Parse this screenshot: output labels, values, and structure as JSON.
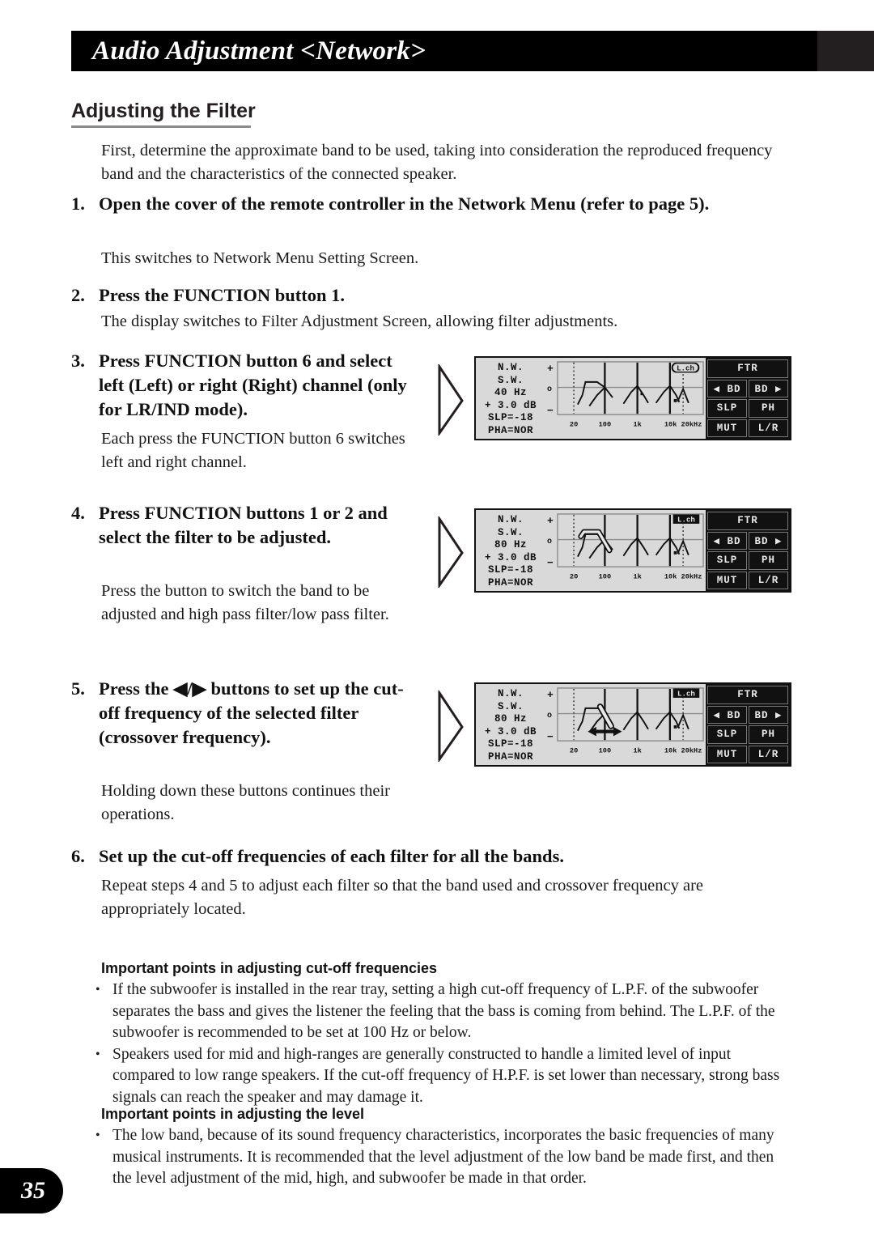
{
  "header": {
    "title": "Audio Adjustment <Network>"
  },
  "section": {
    "heading": "Adjusting the Filter"
  },
  "intro": "First, determine the approximate band to be used, taking into consideration the reproduced frequency band and the characteristics of the connected speaker.",
  "steps": [
    {
      "num": "1.",
      "title": "Open the cover of the remote controller in the Network Menu (refer to page 5).",
      "body": "This switches to Network Menu Setting Screen."
    },
    {
      "num": "2.",
      "title": "Press the FUNCTION button 1.",
      "body": "The display switches to Filter Adjustment Screen, allowing filter adjustments."
    },
    {
      "num": "3.",
      "title": "Press FUNCTION button 6 and select left (Left) or right (Right) channel (only for LR/IND mode).",
      "body": "Each press the FUNCTION button 6 switches left and right channel."
    },
    {
      "num": "4.",
      "title": "Press FUNCTION buttons 1 or 2 and select the filter to be adjusted.",
      "body": "Press the button to switch the band to be adjusted and high pass filter/low pass filter."
    },
    {
      "num": "5.",
      "title": "Press the ◀/▶ buttons to set up the cut-off frequency of the selected filter (crossover frequency).",
      "body": "Holding down these buttons continues their operations."
    },
    {
      "num": "6.",
      "title": "Set up the cut-off frequencies of each filter for all the bands.",
      "body": "Repeat steps 4 and 5 to adjust each filter so that the band used and crossover frequency are appropriately located."
    }
  ],
  "displays": [
    {
      "name": "filter-adjustment-screen-1",
      "labels": [
        "N.W.",
        "S.W.",
        "40 Hz",
        "+ 3.0 dB",
        "SLP=-18",
        "PHA=NOR"
      ],
      "axis_plus": "+",
      "axis_zero": "o",
      "axis_minus": "−",
      "channel_badge": "L.ch",
      "channel_badge_style": "rounded",
      "ticks": [
        "20",
        "100",
        "1k",
        "10k 20kHz"
      ],
      "buttons": [
        "FTR",
        "◀ BD",
        "BD ▶",
        "SLP",
        "PH",
        "MUT",
        "L/R"
      ],
      "highlight": "none",
      "arrow": false
    },
    {
      "name": "filter-adjustment-screen-2",
      "labels": [
        "N.W.",
        "S.W.",
        "80 Hz",
        "+ 3.0 dB",
        "SLP=-18",
        "PHA=NOR"
      ],
      "axis_plus": "+",
      "axis_zero": "o",
      "axis_minus": "−",
      "channel_badge": "L.ch",
      "channel_badge_style": "square",
      "ticks": [
        "20",
        "100",
        "1k",
        "10k 20kHz"
      ],
      "buttons": [
        "FTR",
        "◀ BD",
        "BD ▶",
        "SLP",
        "PH",
        "MUT",
        "L/R"
      ],
      "highlight": "band-outline",
      "arrow": false
    },
    {
      "name": "filter-adjustment-screen-3",
      "labels": [
        "N.W.",
        "S.W.",
        "80 Hz",
        "+ 3.0 dB",
        "SLP=-18",
        "PHA=NOR"
      ],
      "axis_plus": "+",
      "axis_zero": "o",
      "axis_minus": "−",
      "channel_badge": "L.ch",
      "channel_badge_style": "square",
      "ticks": [
        "20",
        "100",
        "1k",
        "10k 20kHz"
      ],
      "buttons": [
        "FTR",
        "◀ BD",
        "BD ▶",
        "SLP",
        "PH",
        "MUT",
        "L/R"
      ],
      "highlight": "slope-outline",
      "arrow": true
    }
  ],
  "notes": [
    {
      "heading": "Important points in adjusting cut-off frequencies",
      "bullets": [
        "If the subwoofer is installed in the rear tray, setting a high cut-off frequency of L.P.F. of the subwoofer separates the bass and gives the listener the feeling that the bass is coming from behind. The L.P.F. of the subwoofer is recommended to be set at 100 Hz or below.",
        "Speakers used for mid and high-ranges are generally constructed to handle a limited level of input compared to low range speakers. If the cut-off frequency of H.P.F. is set lower than necessary, strong bass signals can reach the speaker and may damage it."
      ]
    },
    {
      "heading": "Important points in adjusting the level",
      "bullets": [
        "The low band, because of its sound frequency characteristics, incorporates the basic frequencies of many musical instruments. It is recommended that the level adjustment of the low band be made first, and then the level adjustment of the mid, high, and subwoofer be made in that order."
      ]
    }
  ],
  "page_number": "35"
}
